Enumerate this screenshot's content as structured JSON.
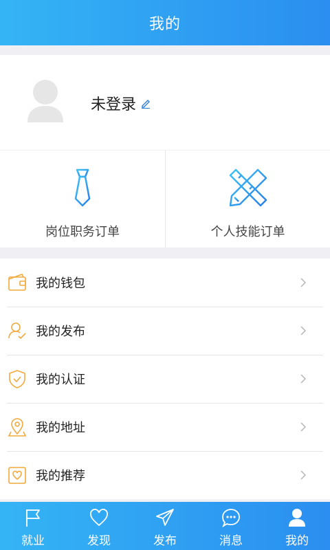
{
  "header": {
    "title": "我的"
  },
  "profile": {
    "name": "未登录"
  },
  "orders": [
    {
      "label": "岗位职务订单",
      "icon": "tie-icon"
    },
    {
      "label": "个人技能订单",
      "icon": "ruler-pencil-icon"
    }
  ],
  "menu": [
    {
      "label": "我的钱包",
      "icon": "wallet-icon"
    },
    {
      "label": "我的发布",
      "icon": "user-check-icon"
    },
    {
      "label": "我的认证",
      "icon": "shield-check-icon"
    },
    {
      "label": "我的地址",
      "icon": "location-pin-icon"
    },
    {
      "label": "我的推荐",
      "icon": "heart-box-icon"
    }
  ],
  "tabs": [
    {
      "label": "就业",
      "icon": "flag-icon"
    },
    {
      "label": "发现",
      "icon": "heart-icon"
    },
    {
      "label": "发布",
      "icon": "paper-plane-icon"
    },
    {
      "label": "消息",
      "icon": "chat-bubble-icon"
    },
    {
      "label": "我的",
      "icon": "person-icon",
      "active": true
    }
  ],
  "colors": {
    "accent": "#2f9ff3",
    "icon_orange": "#f2a93b"
  }
}
